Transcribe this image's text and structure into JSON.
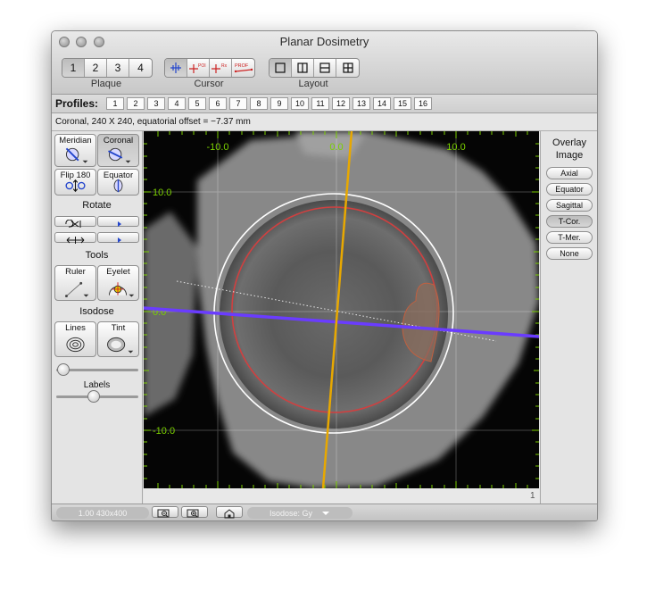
{
  "window": {
    "title": "Planar Dosimetry"
  },
  "toolbar": {
    "plaque": {
      "label": "Plaque",
      "items": [
        "1",
        "2",
        "3",
        "4"
      ],
      "selected": "1"
    },
    "cursor": {
      "label": "Cursor",
      "items": [
        "crosshair",
        "POI",
        "Rx",
        "PROF"
      ],
      "selected": "crosshair"
    },
    "layout": {
      "label": "Layout",
      "items": [
        "single",
        "two-column",
        "two-row",
        "four-grid"
      ],
      "selected": "single"
    }
  },
  "profiles": {
    "label": "Profiles:",
    "items": [
      "1",
      "2",
      "3",
      "4",
      "5",
      "6",
      "7",
      "8",
      "9",
      "10",
      "11",
      "12",
      "13",
      "14",
      "15",
      "16"
    ]
  },
  "info": {
    "text": "Coronal, 240 X 240, equatorial offset = −7.37 mm"
  },
  "left_panel": {
    "view_buttons": [
      {
        "label": "Meridian",
        "icon": "meridian-eye-icon"
      },
      {
        "label": "Coronal",
        "icon": "coronal-eye-icon",
        "selected": true
      },
      {
        "label": "Flip 180",
        "icon": "flip-icon"
      },
      {
        "label": "Equator",
        "icon": "equator-icon"
      }
    ],
    "rotate_label": "Rotate",
    "tools_label": "Tools",
    "tools": [
      {
        "label": "Ruler",
        "icon": "ruler-icon"
      },
      {
        "label": "Eyelet",
        "icon": "eyelet-icon"
      }
    ],
    "isodose_label": "Isodose",
    "isodose": [
      {
        "label": "Lines",
        "icon": "contour-lines-icon"
      },
      {
        "label": "Tint",
        "icon": "tint-icon"
      }
    ],
    "labels_label": "Labels"
  },
  "view": {
    "axis_labels": {
      "top_left": "-10.0",
      "top_center": "0.0",
      "top_right": "10.0",
      "left_top": "10.0",
      "left_mid": "0.0",
      "left_bottom": "-10.0"
    },
    "colors": {
      "ruler": "#7bd000",
      "axis_line": "#6a3cff",
      "rod": "#e8a800",
      "iso_red": "#d04040",
      "iso_white": "#ffffff"
    }
  },
  "right_panel": {
    "title_line1": "Overlay",
    "title_line2": "Image",
    "options": [
      "Axial",
      "Equator",
      "Sagittal",
      "T-Cor.",
      "T-Mer.",
      "None"
    ],
    "selected": "T-Cor."
  },
  "ruler_corner": "1",
  "status": {
    "zoom_text": "1.00 430x400",
    "isodose": "Isodose: Gy"
  }
}
